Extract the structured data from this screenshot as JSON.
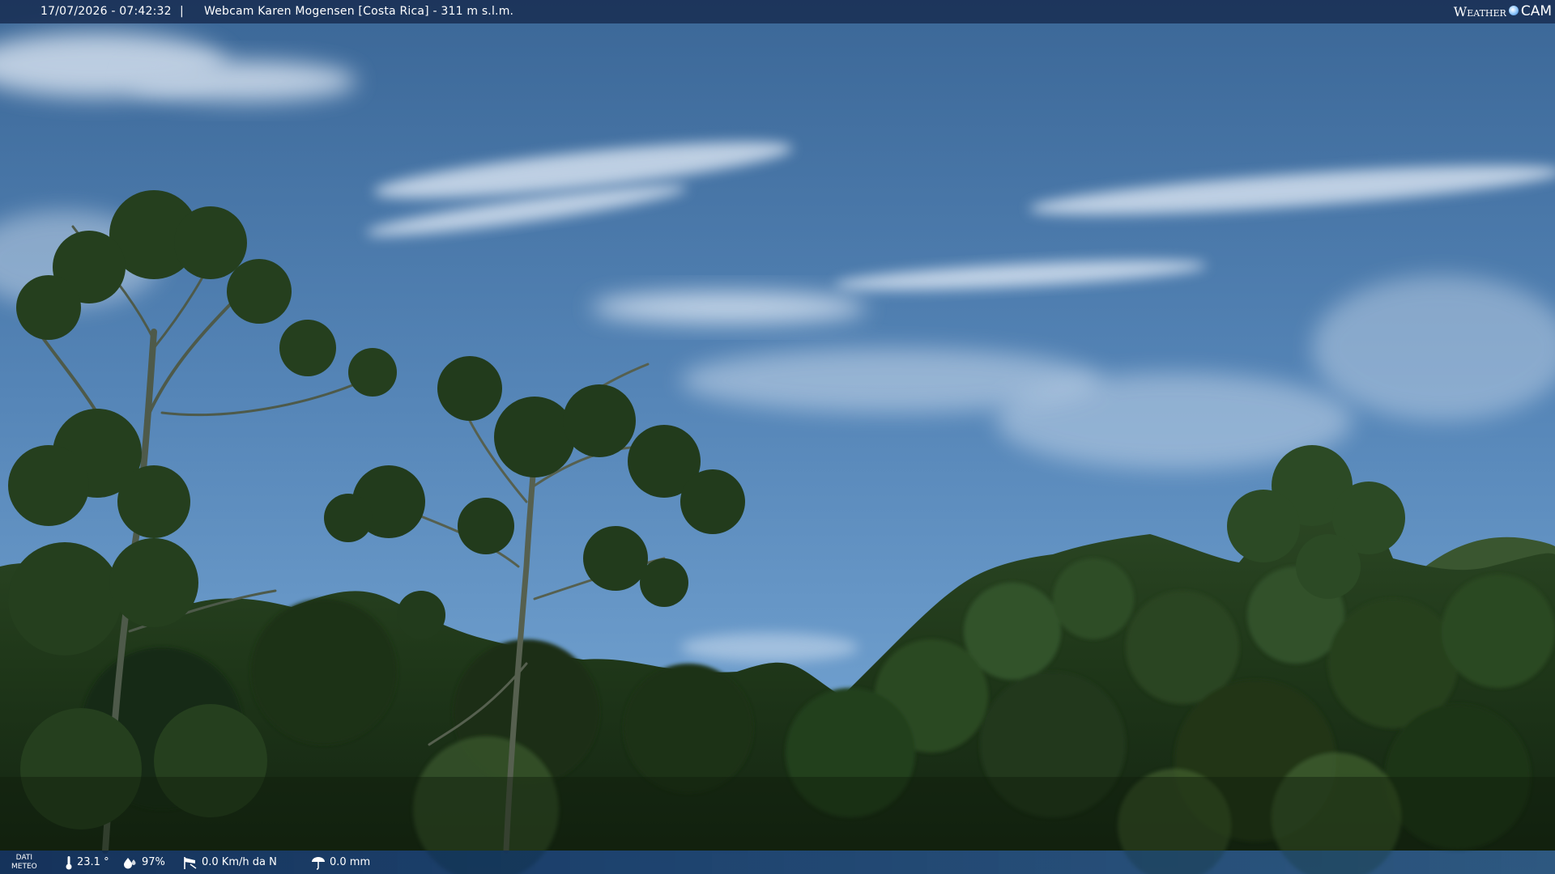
{
  "overlay": {
    "timestamp": "17/07/2026 - 07:42:32",
    "separator": "|",
    "camera_title": "Webcam Karen Mogensen [Costa Rica] - 311 m s.l.m.",
    "brand": {
      "part1": "Weather",
      "part2": "CAM"
    }
  },
  "weather": {
    "label_line1": "DATI",
    "label_line2": "METEO",
    "temperature": "23.1 °",
    "humidity": "97%",
    "wind": "0.0 Km/h da N",
    "rain": "0.0 mm",
    "icons": [
      "thermometer-icon",
      "humidity-drop-icon",
      "wind-sock-icon",
      "rain-umbrella-icon"
    ]
  },
  "colors": {
    "sky_top": "#3f6c9d",
    "sky_horizon": "#6f9fcf",
    "foliage": "#1e3418",
    "bar": "#14284b"
  }
}
